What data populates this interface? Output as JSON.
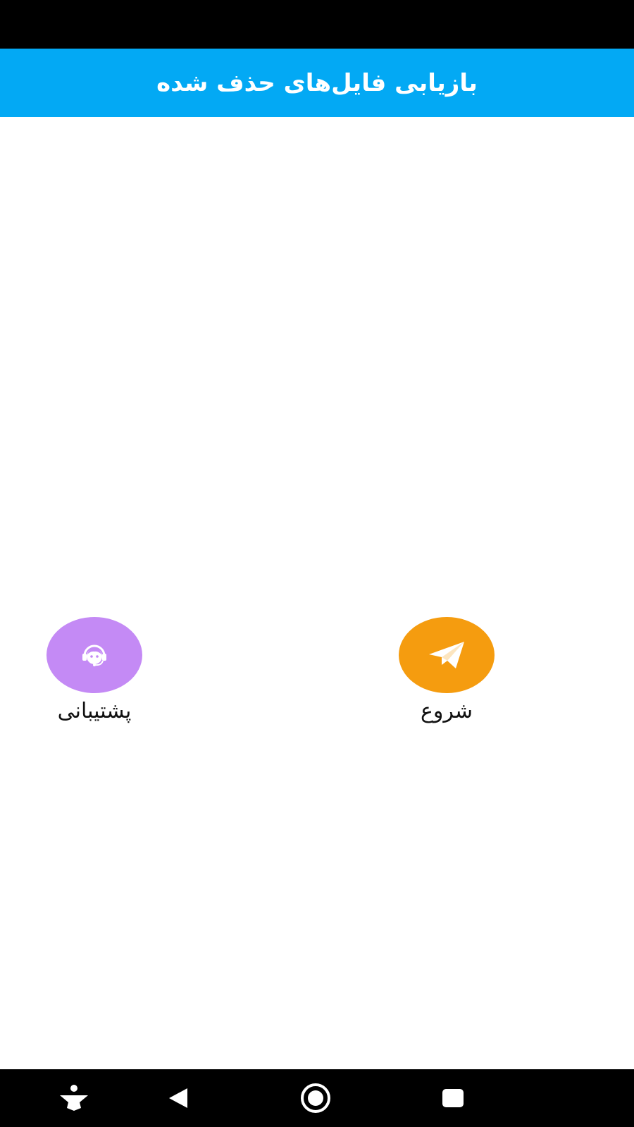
{
  "app_bar": {
    "title": "بازیابی فایل‌های حذف شده"
  },
  "actions": {
    "support": {
      "label": "پشتیبانی",
      "icon": "support-agent-icon",
      "color": "#c48af5"
    },
    "start": {
      "label": "شروع",
      "icon": "paper-plane-icon",
      "color": "#f59c0f"
    }
  },
  "colors": {
    "app_bar": "#03a9f4",
    "status_bar": "#000000",
    "nav_bar": "#000000",
    "background": "#ffffff"
  },
  "navigation": {
    "icons": [
      "accessibility-icon",
      "back-icon",
      "home-icon",
      "recents-icon"
    ]
  }
}
